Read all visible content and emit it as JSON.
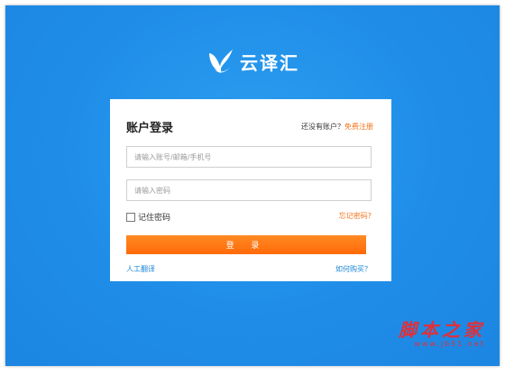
{
  "brand": {
    "name": "云译汇"
  },
  "login": {
    "title": "账户登录",
    "no_account_text": "还没有账户？",
    "register_link": "免费注册",
    "account_placeholder": "请输入账号/邮箱/手机号",
    "password_placeholder": "请输入密码",
    "remember_label": "记住密码",
    "forgot_link": "忘记密码?",
    "login_button": "登 录",
    "manual_translation": "人工翻译",
    "how_to_buy": "如何购买？"
  },
  "watermark": {
    "title": "脚本之家",
    "url": "www.jb51.net"
  },
  "colors": {
    "background": "#1f8de8",
    "accent_orange": "#ff7410",
    "link_blue": "#1f88d8"
  }
}
